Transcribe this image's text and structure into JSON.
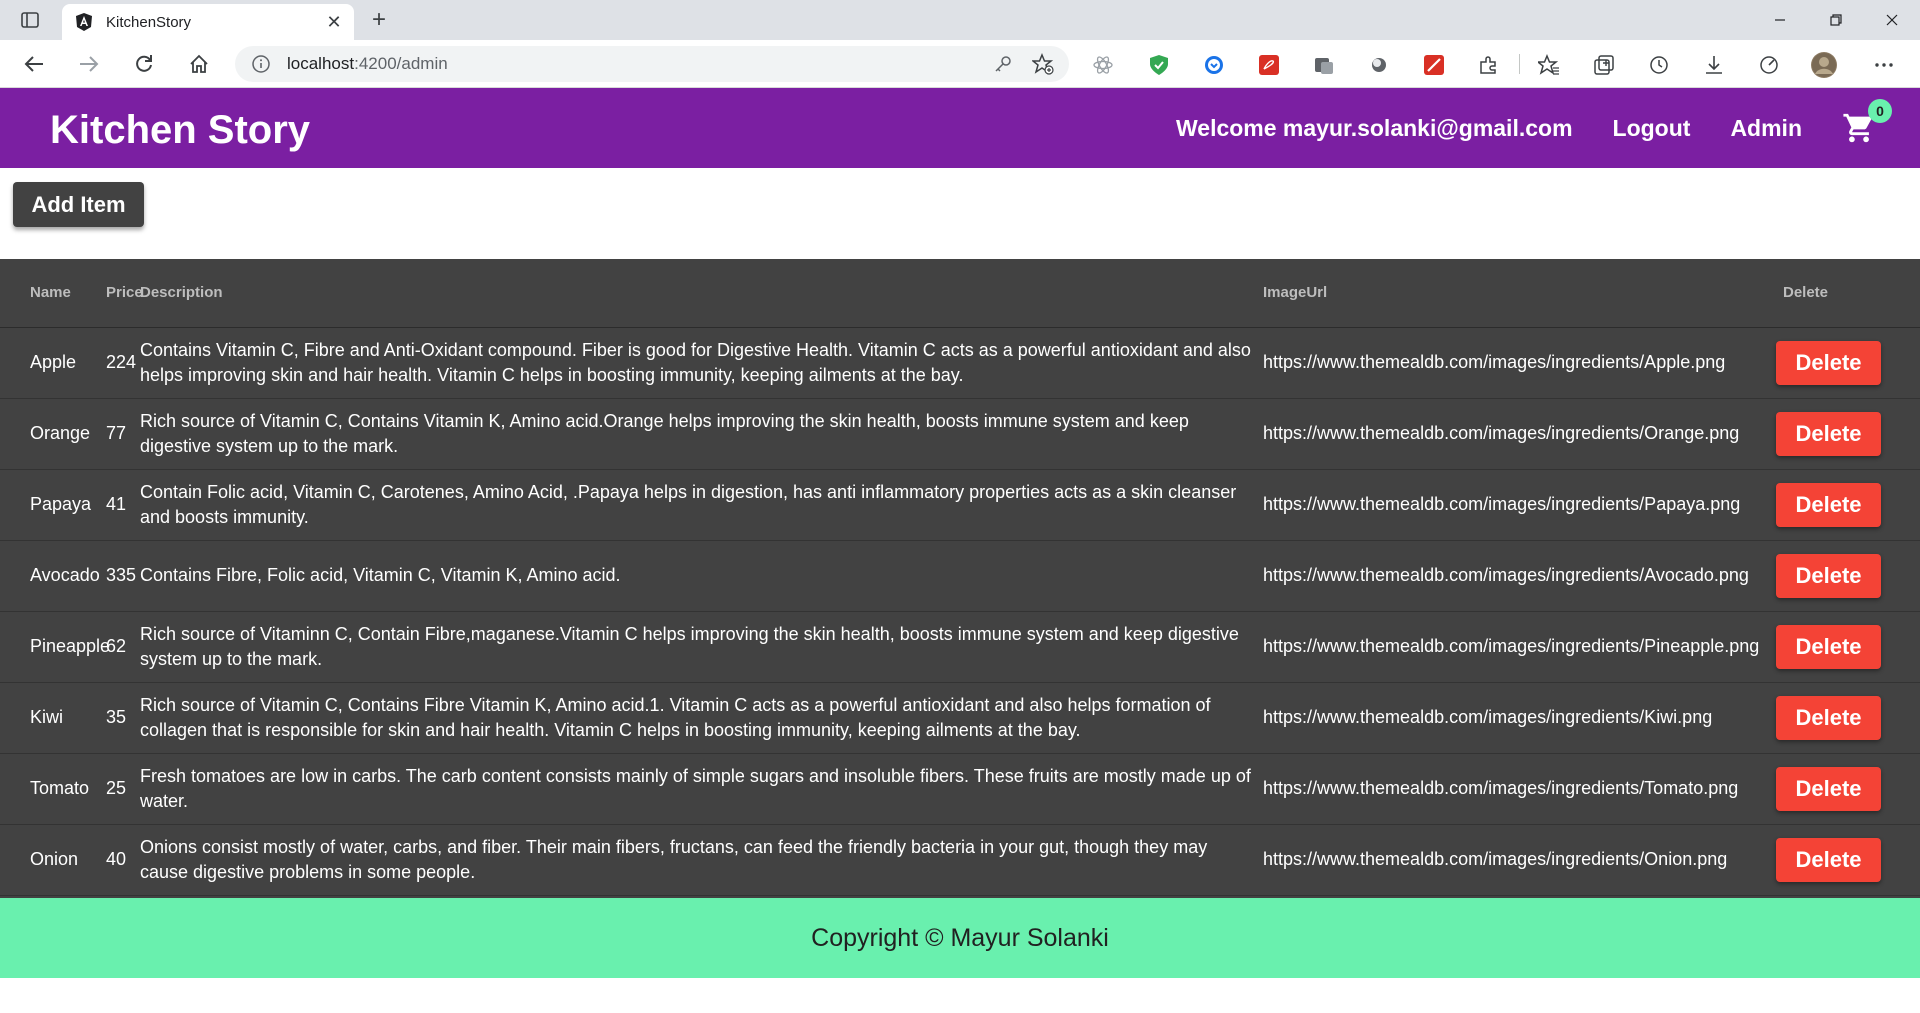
{
  "browser": {
    "tab_title": "KitchenStory",
    "url_host": "localhost",
    "url_rest": ":4200/admin",
    "new_tab": "+",
    "close_tab": "✕"
  },
  "header": {
    "brand": "Kitchen Story",
    "welcome": "Welcome mayur.solanki@gmail.com",
    "logout": "Logout",
    "admin": "Admin",
    "cart_count": "0"
  },
  "content": {
    "add_item_label": "Add Item"
  },
  "table": {
    "columns": {
      "name": "Name",
      "price": "Price",
      "description": "Description",
      "image_url": "ImageUrl",
      "delete": "Delete"
    },
    "delete_label": "Delete",
    "rows": [
      {
        "name": "Apple",
        "price": "224",
        "description": "Contains Vitamin C, Fibre and Anti-Oxidant compound. Fiber is good for Digestive Health. Vitamin C acts as a powerful antioxidant and also helps improving skin and hair health. Vitamin C helps in boosting immunity, keeping ailments at the bay.",
        "image_url": "https://www.themealdb.com/images/ingredients/Apple.png"
      },
      {
        "name": "Orange",
        "price": "77",
        "description": "Rich source of Vitamin C, Contains Vitamin K, Amino acid.Orange helps improving the skin health, boosts immune system and keep digestive system up to the mark.",
        "image_url": "https://www.themealdb.com/images/ingredients/Orange.png"
      },
      {
        "name": "Papaya",
        "price": "41",
        "description": "Contain Folic acid, Vitamin C, Carotenes, Amino Acid, .Papaya helps in digestion, has anti inflammatory properties acts as a skin cleanser and boosts immunity.",
        "image_url": "https://www.themealdb.com/images/ingredients/Papaya.png"
      },
      {
        "name": "Avocado",
        "price": "335",
        "description": "Contains Fibre, Folic acid, Vitamin C, Vitamin K, Amino acid.",
        "image_url": "https://www.themealdb.com/images/ingredients/Avocado.png"
      },
      {
        "name": "Pineapple",
        "price": "62",
        "description": "Rich source of Vitaminn C, Contain Fibre,maganese.Vitamin C helps improving the skin health, boosts immune system and keep digestive system up to the mark.",
        "image_url": "https://www.themealdb.com/images/ingredients/Pineapple.png"
      },
      {
        "name": "Kiwi",
        "price": "35",
        "description": "Rich source of Vitamin C, Contains Fibre Vitamin K, Amino acid.1. Vitamin C acts as a powerful antioxidant and also helps formation of collagen that is responsible for skin and hair health. Vitamin C helps in boosting immunity, keeping ailments at the bay.",
        "image_url": "https://www.themealdb.com/images/ingredients/Kiwi.png"
      },
      {
        "name": "Tomato",
        "price": "25",
        "description": "Fresh tomatoes are low in carbs. The carb content consists mainly of simple sugars and insoluble fibers. These fruits are mostly made up of water.",
        "image_url": "https://www.themealdb.com/images/ingredients/Tomato.png"
      },
      {
        "name": "Onion",
        "price": "40",
        "description": "Onions consist mostly of water, carbs, and fiber. Their main fibers, fructans, can feed the friendly bacteria in your gut, though they may cause digestive problems in some people.",
        "image_url": "https://www.themealdb.com/images/ingredients/Onion.png"
      }
    ]
  },
  "footer": {
    "copyright": "Copyright © Mayur Solanki"
  },
  "colors": {
    "header_bg": "#7b1fa2",
    "table_bg": "#424242",
    "delete_bg": "#f44336",
    "footer_bg": "#69f0ae"
  }
}
